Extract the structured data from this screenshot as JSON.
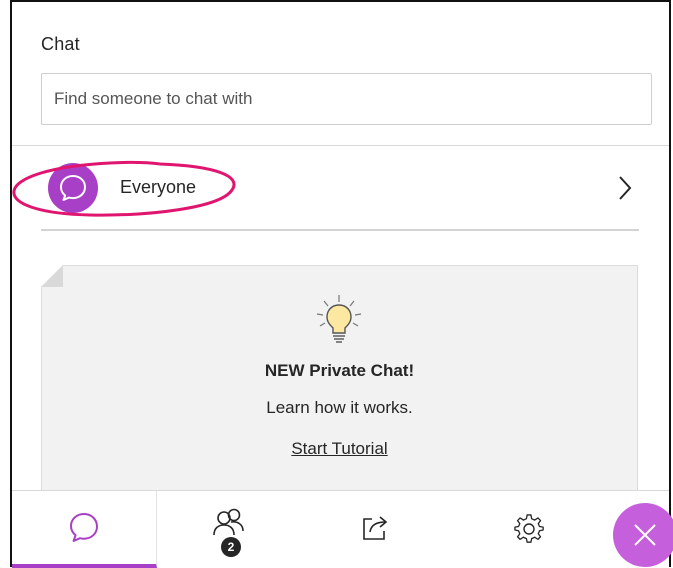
{
  "panel": {
    "title": "Chat"
  },
  "search": {
    "placeholder": "Find someone to chat with",
    "value": ""
  },
  "conversations": [
    {
      "label": "Everyone",
      "icon": "chat-bubble-icon",
      "avatar_color": "#a83fc7"
    }
  ],
  "tutorial_card": {
    "heading": "NEW Private Chat!",
    "subtext": "Learn how it works.",
    "link_label": "Start Tutorial",
    "icon": "lightbulb-icon"
  },
  "bottom_nav": {
    "tabs": [
      {
        "name": "chat",
        "icon": "chat-bubble-icon",
        "active": true
      },
      {
        "name": "attendees",
        "icon": "people-icon",
        "badge": "2"
      },
      {
        "name": "share-content",
        "icon": "share-icon"
      },
      {
        "name": "settings",
        "icon": "gear-icon"
      }
    ],
    "close_icon": "close-icon"
  },
  "colors": {
    "accent": "#a83fc7",
    "close_button": "#c55fdb",
    "highlight_ellipse": "#e0156f",
    "card_background": "#f2f2f2"
  }
}
